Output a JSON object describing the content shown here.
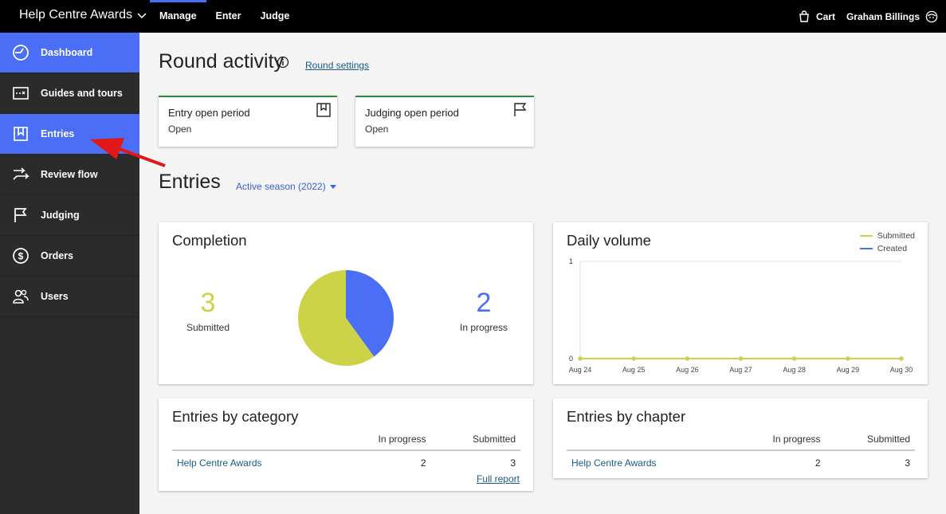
{
  "topbar": {
    "app_title": "Help Centre Awards",
    "nav": [
      "Manage",
      "Enter",
      "Judge"
    ],
    "cart_label": "Cart",
    "user_name": "Graham Billings"
  },
  "sidebar": {
    "items": [
      {
        "label": "Dashboard",
        "icon": "dashboard-icon"
      },
      {
        "label": "Guides and tours",
        "icon": "map-icon"
      },
      {
        "label": "Entries",
        "icon": "bookmark-icon"
      },
      {
        "label": "Review flow",
        "icon": "review-flow-icon"
      },
      {
        "label": "Judging",
        "icon": "flag-icon"
      },
      {
        "label": "Orders",
        "icon": "dollar-icon"
      },
      {
        "label": "Users",
        "icon": "users-icon"
      }
    ]
  },
  "round": {
    "title": "Round activity",
    "settings_link": "Round settings",
    "periods": [
      {
        "title": "Entry open period",
        "status": "Open",
        "icon": "bookmark-icon"
      },
      {
        "title": "Judging open period",
        "status": "Open",
        "icon": "flag-icon"
      }
    ]
  },
  "entries": {
    "title": "Entries",
    "season": "Active season (2022)"
  },
  "completion": {
    "title": "Completion",
    "submitted_value": "3",
    "submitted_label": "Submitted",
    "in_progress_value": "2",
    "in_progress_label": "In progress"
  },
  "daily_volume": {
    "title": "Daily volume"
  },
  "by_category": {
    "title": "Entries by category",
    "columns": [
      "",
      "In progress",
      "Submitted"
    ],
    "rows": [
      [
        "Help Centre Awards",
        "2",
        "3"
      ]
    ],
    "full_report": "Full report"
  },
  "by_chapter": {
    "title": "Entries by chapter",
    "columns": [
      "",
      "In progress",
      "Submitted"
    ],
    "rows": [
      [
        "Help Centre Awards",
        "2",
        "3"
      ]
    ]
  },
  "colors": {
    "accent": "#4a6ef5",
    "submitted": "#cdd346",
    "in_progress": "#4a6ef5",
    "period_border": "#2c8a3c",
    "annotation": "#e01818"
  },
  "chart_data": [
    {
      "type": "pie",
      "labels": [
        "Submitted",
        "In progress"
      ],
      "values": [
        3,
        2
      ],
      "colors": [
        "#cdd346",
        "#4a6ef5"
      ]
    },
    {
      "type": "line",
      "x": [
        "Aug 24",
        "Aug 25",
        "Aug 26",
        "Aug 27",
        "Aug 28",
        "Aug 29",
        "Aug 30"
      ],
      "series": [
        {
          "name": "Submitted",
          "values": [
            0,
            0,
            0,
            0,
            0,
            0,
            0
          ],
          "color": "#cdd346"
        },
        {
          "name": "Created",
          "values": [
            0,
            0,
            0,
            0,
            0,
            0,
            0
          ],
          "color": "#4a6ef5"
        }
      ],
      "ylim": [
        0,
        1
      ],
      "yticks": [
        0,
        1
      ],
      "legend": "top-right",
      "grid": true
    }
  ]
}
